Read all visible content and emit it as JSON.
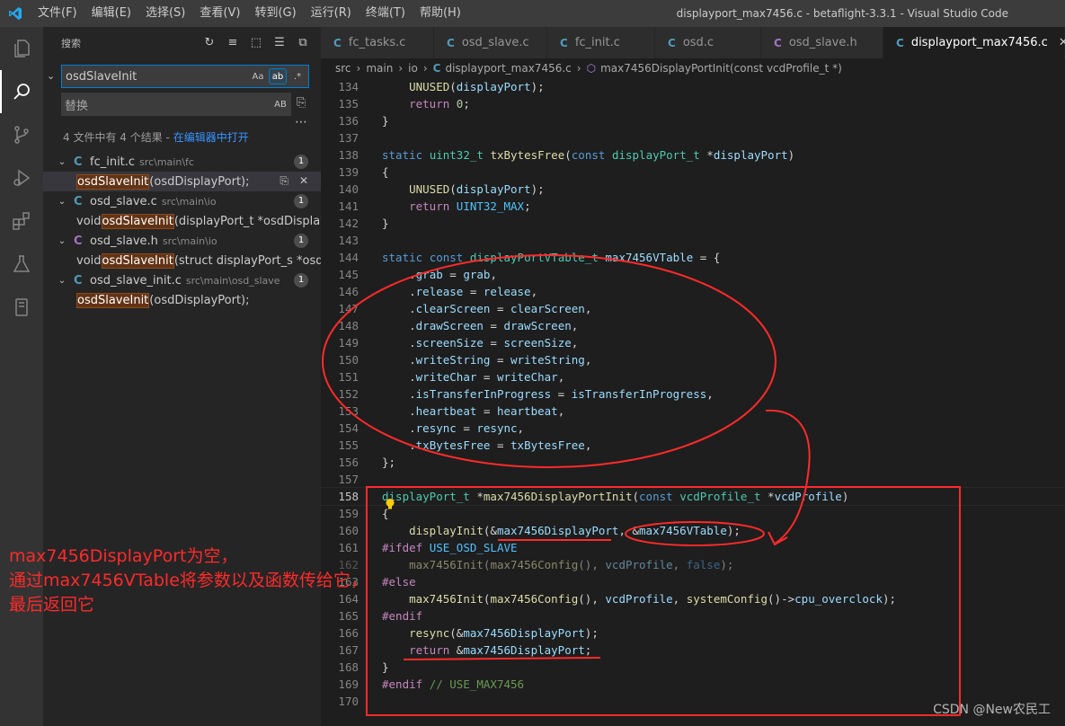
{
  "titlebar": {
    "menu": [
      "文件(F)",
      "编辑(E)",
      "选择(S)",
      "查看(V)",
      "转到(G)",
      "运行(R)",
      "终端(T)",
      "帮助(H)"
    ],
    "window_title": "displayport_max7456.c - betaflight-3.3.1 - Visual Studio Code"
  },
  "activity_bar": [
    "files-icon",
    "search-icon",
    "source-control-icon",
    "run-debug-icon",
    "extensions-icon",
    "testing-icon",
    "device-icon"
  ],
  "sidebar": {
    "title": "搜索",
    "search_value": "osdSlaveInit",
    "option_case": "Aa",
    "option_word": "ab",
    "option_regex": ".*",
    "replace_placeholder": "替换",
    "replace_preserve_case": "AB",
    "summary": "4 文件中有 4 个结果 - ",
    "open_in_editor": "在编辑器中打开",
    "results": [
      {
        "file": "fc_init.c",
        "path": "src\\main\\fc",
        "icon": "C",
        "count": "1",
        "match_before": "",
        "match": "osdSlaveInit",
        "match_after": "(osdDisplayPort);"
      },
      {
        "file": "osd_slave.c",
        "path": "src\\main\\io",
        "icon": "C",
        "count": "1",
        "match_before": "void ",
        "match": "osdSlaveInit",
        "match_after": "(displayPort_t *osdDisplayPo..."
      },
      {
        "file": "osd_slave.h",
        "path": "src\\main\\io",
        "icon": "C",
        "count": "1",
        "match_before": "void ",
        "match": "osdSlaveInit",
        "match_after": "(struct displayPort_s *osdDis..."
      },
      {
        "file": "osd_slave_init.c",
        "path": "src\\main\\osd_slave",
        "icon": "C",
        "count": "1",
        "match_before": "",
        "match": "osdSlaveInit",
        "match_after": "(osdDisplayPort);"
      }
    ]
  },
  "editor": {
    "tabs": [
      {
        "label": "fc_tasks.c",
        "icon": "C",
        "active": false
      },
      {
        "label": "osd_slave.c",
        "icon": "C",
        "active": false
      },
      {
        "label": "fc_init.c",
        "icon": "C",
        "active": false
      },
      {
        "label": "osd.c",
        "icon": "C",
        "active": false
      },
      {
        "label": "osd_slave.h",
        "icon": "C",
        "active": false
      },
      {
        "label": "displayport_max7456.c",
        "icon": "C",
        "active": true
      }
    ],
    "breadcrumb": {
      "parts": [
        "src",
        "main",
        "io"
      ],
      "file": "displayport_max7456.c",
      "symbol": "max7456DisplayPortInit(const vcdProfile_t *)"
    },
    "current_line": 158
  },
  "annotation": {
    "note_lines": [
      "max7456DisplayPort为空，",
      "通过max7456VTable将参数以及函数传给它，",
      "最后返回它"
    ],
    "watermark": "CSDN @New农民工",
    "annotation_color": "#ff2a2a"
  }
}
